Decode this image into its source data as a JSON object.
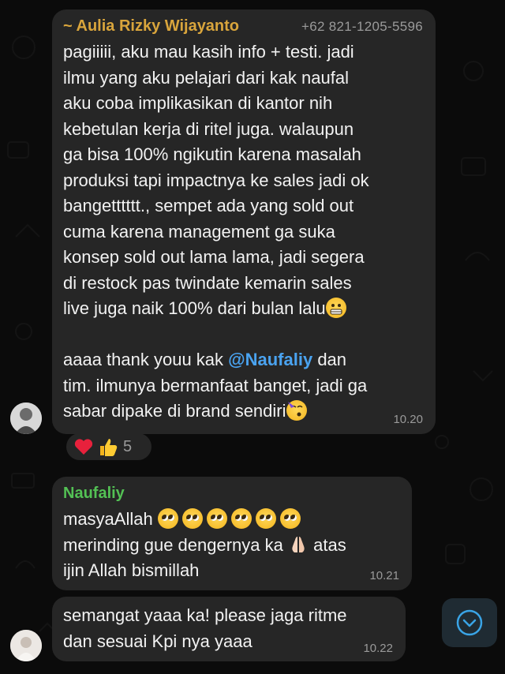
{
  "messages": [
    {
      "sender": "~ Aulia Rizky Wijayanto",
      "phone": "+62 821-1205-5596",
      "lines": [
        "pagiiiii, aku mau kasih info + testi. jadi",
        "ilmu yang aku pelajari dari kak naufal",
        "aku coba implikasikan di kantor nih",
        "kebetulan kerja di ritel juga. walaupun",
        "ga bisa 100% ngikutin karena masalah",
        "produksi tapi impactnya ke sales jadi ok",
        "bangetttttt., sempet ada yang sold out",
        "cuma karena management ga suka",
        "konsep sold out lama lama, jadi segera",
        "di restock pas twindate kemarin sales",
        "live juga naik 100% dari bulan lalu",
        "",
        "aaaa thank youu kak ",
        "tim. ilmunya bermanfaat banget, jadi ga",
        "sabar dipake di brand sendiri"
      ],
      "mention": "@Naufaliy",
      "after_mention": " dan",
      "time": "10.20",
      "reaction_count": "5"
    },
    {
      "sender": "Naufaliy",
      "line1": "masyaAllah",
      "line2a": "merinding gue dengernya ka",
      "line2b": "atas",
      "line3": "ijin Allah bismillah",
      "time": "10.21"
    },
    {
      "lines": [
        "semangat yaaa ka! please jaga ritme",
        "dan sesuai Kpi nya yaaa"
      ],
      "time": "10.22"
    }
  ],
  "colors": {
    "sender1_name": "#d9a53c",
    "sender2_name": "#53c154",
    "mention": "#4aa3f0",
    "bubble": "#262626",
    "background": "#0b0b0b"
  },
  "icons": [
    "heart-icon",
    "thumbs-up-icon",
    "grimace-emoji",
    "party-emoji",
    "pleading-emoji",
    "praying-hands-emoji",
    "chevron-down-icon"
  ]
}
